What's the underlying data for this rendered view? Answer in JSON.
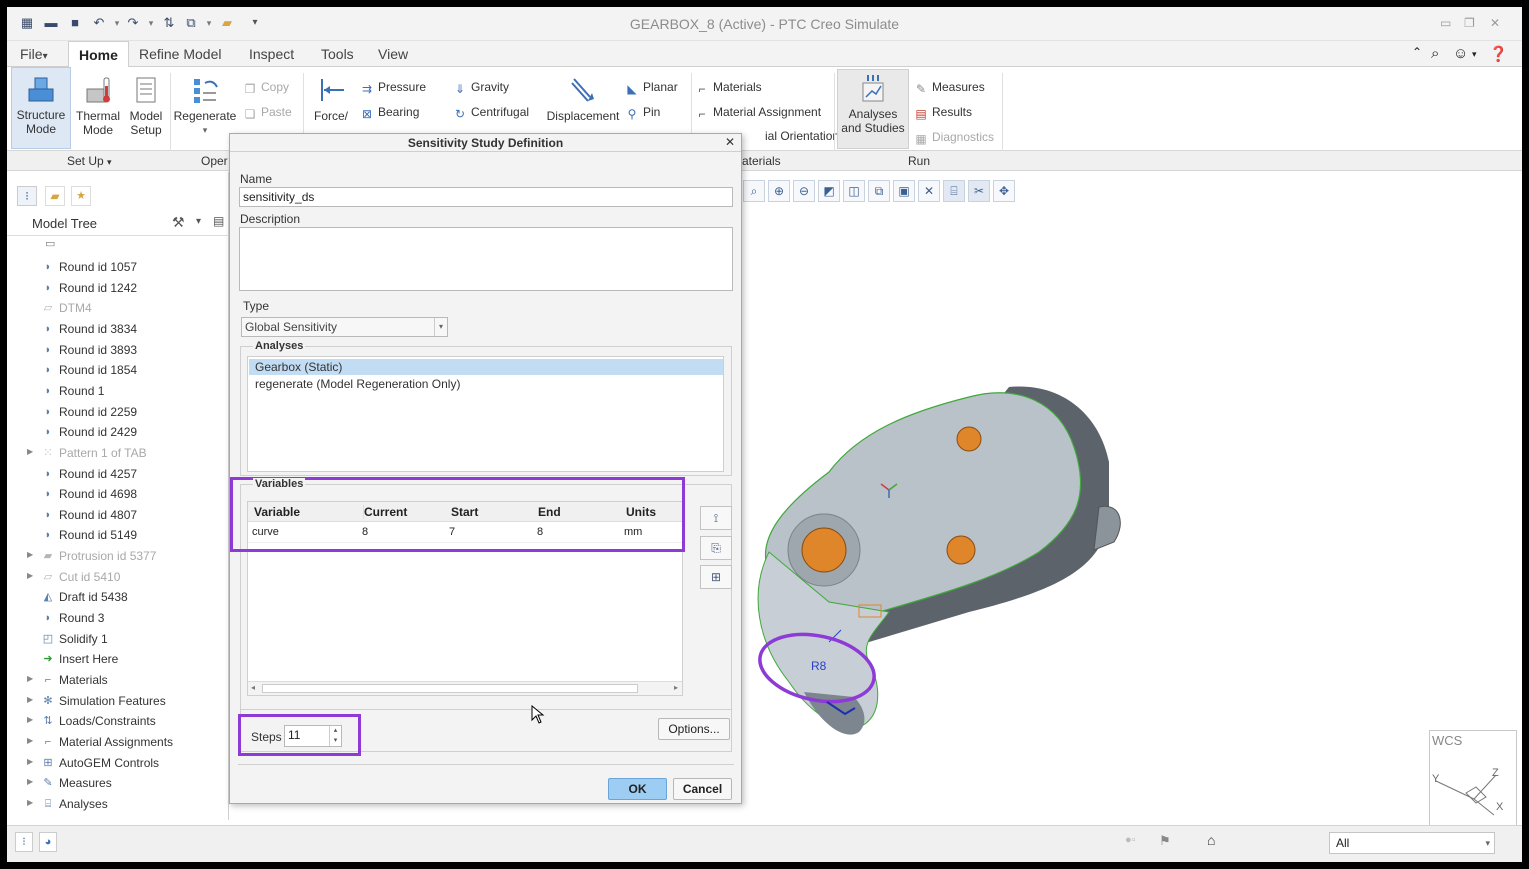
{
  "window": {
    "title": "GEARBOX_8 (Active) - PTC Creo Simulate"
  },
  "ribbon": {
    "tabs": [
      {
        "label": "File",
        "arrow": "▾"
      },
      {
        "label": "Home"
      },
      {
        "label": "Refine Model"
      },
      {
        "label": "Inspect"
      },
      {
        "label": "Tools"
      },
      {
        "label": "View"
      }
    ],
    "big_buttons": {
      "structure": [
        "Structure",
        "Mode"
      ],
      "thermal": [
        "Thermal",
        "Mode"
      ],
      "model_setup": [
        "Model",
        "Setup"
      ],
      "regenerate": "Regenerate",
      "force": "Force/",
      "displacement": "Displacement",
      "analyses": [
        "Analyses",
        "and Studies"
      ]
    },
    "small_buttons": {
      "copy": "Copy",
      "paste": "Paste",
      "pressure": "Pressure",
      "bearing": "Bearing",
      "gravity": "Gravity",
      "centrifugal": "Centrifugal",
      "planar": "Planar",
      "pin": "Pin",
      "materials": "Materials",
      "material_assignment": "Material Assignment",
      "material_orientations": "ial Orientations",
      "measures": "Measures",
      "results": "Results",
      "diagnostics": "Diagnostics"
    },
    "groups": {
      "setup": "Set Up",
      "setup_arrow": "▾",
      "open": "Oper",
      "materials": "aterials",
      "run": "Run"
    }
  },
  "model_tree": {
    "title": "Model Tree",
    "items": [
      {
        "label": "Round id 1057",
        "dim": false,
        "expandable": false,
        "icon": "round-icon"
      },
      {
        "label": "Round id 1242",
        "dim": false,
        "expandable": false,
        "icon": "round-icon"
      },
      {
        "label": "DTM4",
        "dim": true,
        "expandable": false,
        "icon": "datum-plane-icon"
      },
      {
        "label": "Round id 3834",
        "dim": false,
        "expandable": false,
        "icon": "round-icon"
      },
      {
        "label": "Round id 3893",
        "dim": false,
        "expandable": false,
        "icon": "round-icon"
      },
      {
        "label": "Round id 1854",
        "dim": false,
        "expandable": false,
        "icon": "round-icon"
      },
      {
        "label": "Round 1",
        "dim": false,
        "expandable": false,
        "icon": "round-icon"
      },
      {
        "label": "Round id 2259",
        "dim": false,
        "expandable": false,
        "icon": "round-icon"
      },
      {
        "label": "Round id 2429",
        "dim": false,
        "expandable": false,
        "icon": "round-icon"
      },
      {
        "label": "Pattern 1 of TAB",
        "dim": true,
        "expandable": true,
        "icon": "pattern-icon"
      },
      {
        "label": "Round id 4257",
        "dim": false,
        "expandable": false,
        "icon": "round-icon"
      },
      {
        "label": "Round id 4698",
        "dim": false,
        "expandable": false,
        "icon": "round-icon"
      },
      {
        "label": "Round id 4807",
        "dim": false,
        "expandable": false,
        "icon": "round-icon"
      },
      {
        "label": "Round id 5149",
        "dim": false,
        "expandable": false,
        "icon": "round-icon"
      },
      {
        "label": "Protrusion id 5377",
        "dim": true,
        "expandable": true,
        "icon": "protrusion-icon"
      },
      {
        "label": "Cut id 5410",
        "dim": true,
        "expandable": true,
        "icon": "cut-icon"
      },
      {
        "label": "Draft id 5438",
        "dim": false,
        "expandable": false,
        "icon": "draft-icon"
      },
      {
        "label": "Round 3",
        "dim": false,
        "expandable": false,
        "icon": "round-icon"
      },
      {
        "label": "Solidify 1",
        "dim": false,
        "expandable": false,
        "icon": "solidify-icon"
      },
      {
        "label": "Insert Here",
        "dim": false,
        "expandable": false,
        "icon": "insert-here-icon"
      },
      {
        "label": "Materials",
        "dim": false,
        "expandable": true,
        "icon": "materials-icon"
      },
      {
        "label": "Simulation Features",
        "dim": false,
        "expandable": true,
        "icon": "simulation-features-icon"
      },
      {
        "label": "Loads/Constraints",
        "dim": false,
        "expandable": true,
        "icon": "loads-constraints-icon"
      },
      {
        "label": "Material Assignments",
        "dim": false,
        "expandable": true,
        "icon": "material-assignments-icon"
      },
      {
        "label": "AutoGEM Controls",
        "dim": false,
        "expandable": true,
        "icon": "autogem-icon"
      },
      {
        "label": "Measures",
        "dim": false,
        "expandable": true,
        "icon": "measures-icon"
      },
      {
        "label": "Analyses",
        "dim": false,
        "expandable": true,
        "icon": "analyses-icon"
      }
    ]
  },
  "dialog": {
    "title": "Sensitivity Study Definition",
    "name_label": "Name",
    "name_value": "sensitivity_ds",
    "description_label": "Description",
    "description_value": "",
    "type_label": "Type",
    "type_value": "Global Sensitivity",
    "analyses_label": "Analyses",
    "analyses": [
      {
        "label": "Gearbox (Static)",
        "selected": true
      },
      {
        "label": "regenerate (Model Regeneration Only)",
        "selected": false
      }
    ],
    "variables_label": "Variables",
    "variables_columns": [
      "Variable",
      "Current",
      "Start",
      "End",
      "Units"
    ],
    "variables_rows": [
      [
        "curve",
        "8",
        "7",
        "8",
        "mm"
      ]
    ],
    "steps_label": "Steps",
    "steps_value": "11",
    "options_label": "Options...",
    "ok_label": "OK",
    "cancel_label": "Cancel"
  },
  "graphics": {
    "dimension_label": "R8",
    "csys_label": "WCS",
    "axis_z": "Z",
    "axis_x": "X",
    "axis_y": "Y"
  },
  "statusbar": {
    "filter_value": "All"
  },
  "colors": {
    "highlight": "#8d3ad6",
    "selection": "#c2dcf4",
    "ok_button": "#9ecdf3",
    "part_surface": "#b9c1c9",
    "part_edge": "#3fa93a",
    "hole": "#e0862a"
  }
}
